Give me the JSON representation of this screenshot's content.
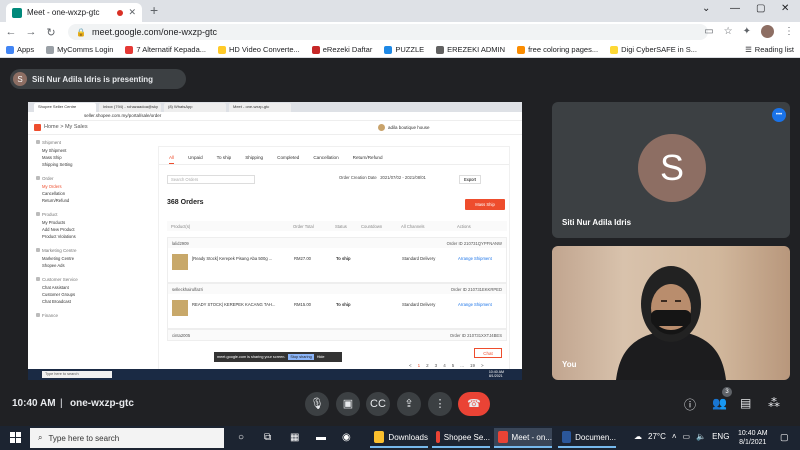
{
  "browser": {
    "tab_title": "Meet - one-wxzp-gtc",
    "url": "meet.google.com/one-wxzp-gtc",
    "bookmarks": [
      {
        "label": "Apps",
        "color": "#4285f4"
      },
      {
        "label": "MyComms Login",
        "color": "#9aa0a6"
      },
      {
        "label": "7 Alternatif Kepada...",
        "color": "#e53935"
      },
      {
        "label": "HD Video Converte...",
        "color": "#ffca28"
      },
      {
        "label": "eRezeki Daftar",
        "color": "#c62828"
      },
      {
        "label": "PUZZLE",
        "color": "#1e88e5"
      },
      {
        "label": "EREZEKI ADMIN",
        "color": "#616161"
      },
      {
        "label": "free coloring pages...",
        "color": "#fb8c00"
      },
      {
        "label": "Digi CyberSAFE in S...",
        "color": "#fdd835"
      }
    ],
    "reading_list": "Reading list"
  },
  "meet": {
    "presenting_banner": "Siti Nur Adila Idris is presenting",
    "presenter_initial": "S",
    "presenter_name": "Siti Nur Adila Idris",
    "self_label": "You",
    "time": "10:40 AM",
    "separator": "|",
    "meeting_code": "one-wxzp-gtc",
    "participant_count": "3"
  },
  "shared": {
    "tabs": [
      "Shopee Seller Centre",
      "Inbox (794) - rohazaadoa@sky",
      "(8) WhatsApp",
      "Meet - one-wxzp-gtc"
    ],
    "url": "seller.shopee.com.my/portal/sale/order",
    "breadcrumb_home": "Home",
    "breadcrumb_sep": ">",
    "breadcrumb_page": "My Sales",
    "shop_name": "adila boutique house",
    "sidebar": [
      {
        "title": "Shipment",
        "items": [
          "My Shipment",
          "Mass Ship",
          "Shipping Setting"
        ]
      },
      {
        "title": "Order",
        "items": [
          "My Orders",
          "Cancellation",
          "Return/Refund"
        ]
      },
      {
        "title": "Product",
        "items": [
          "My Products",
          "Add New Product",
          "Product Violations"
        ]
      },
      {
        "title": "Marketing Centre",
        "items": [
          "Marketing Centre",
          "Shopee Ads"
        ]
      },
      {
        "title": "Customer Service",
        "items": [
          "Chat Assistant",
          "Customer Groups",
          "Chat Broadcast"
        ]
      },
      {
        "title": "Finance",
        "items": []
      }
    ],
    "order_tabs": [
      "All",
      "Unpaid",
      "To ship",
      "Shipping",
      "Completed",
      "Cancellation",
      "Return/Refund"
    ],
    "search_placeholder": "Search Orders",
    "order_date_label": "Order Creation Date",
    "date_range": "2021/07/02 - 2021/08/01",
    "export_label": "Export",
    "order_count": "368 Orders",
    "mass_ship_label": "Mass Ship",
    "columns": [
      "Product(s)",
      "Order Total",
      "Status",
      "Countdown",
      "All Channels",
      "Actions"
    ],
    "orders": [
      {
        "buyer": "lalid2909",
        "order_id": "Order ID 210731QYPFNANW",
        "product": "[Ready Stock] Kerepek Pisang Aba 500g ...",
        "total": "RM27.00",
        "status": "To ship",
        "channel": "Standard Delivery",
        "action": "Arrange Shipment"
      },
      {
        "buyer": "selleckhairulfazri",
        "order_id": "Order ID 210731EKKRPED",
        "product": "READY STOCK| KEREPEK KACANG TAH...",
        "total": "RM15.00",
        "status": "To ship",
        "channel": "Standard Delivery",
        "action": "Arrange Shipment"
      },
      {
        "buyer": "cinta2005",
        "order_id": "Order ID 210731XXTJ4BES",
        "product": "",
        "total": "",
        "status": "",
        "channel": "",
        "action": ""
      }
    ],
    "pages": [
      "<",
      "1",
      "2",
      "3",
      "4",
      "5",
      "...",
      "19",
      ">"
    ],
    "chat_label": "Chat",
    "notification_text": "meet.google.com is sharing your screen.",
    "notification_stop": "Stop sharing",
    "notification_hide": "Hide",
    "taskbar_search": "Type here to search",
    "taskbar_time": "10:40 AM",
    "taskbar_date": "8/1/2021"
  },
  "taskbar": {
    "search_placeholder": "Type here to search",
    "apps": [
      {
        "label": "Downloads",
        "color": "#fbc02d"
      },
      {
        "label": "Shopee Se...",
        "color": "#ea4335"
      },
      {
        "label": "Meet - on...",
        "color": "#ea4335"
      },
      {
        "label": "Documen...",
        "color": "#2b579a"
      }
    ],
    "temperature": "27°C",
    "language": "ENG",
    "time": "10:40 AM",
    "date": "8/1/2021"
  }
}
